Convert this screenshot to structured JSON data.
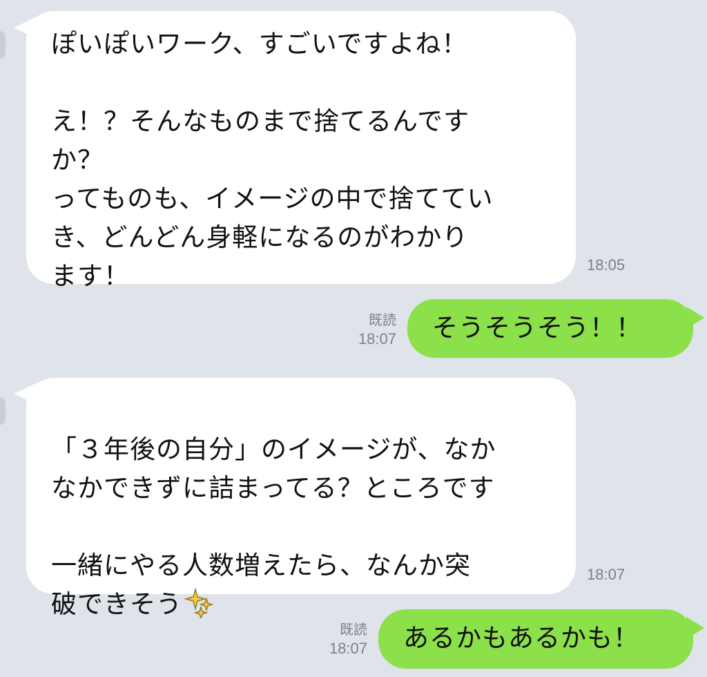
{
  "messages": [
    {
      "id": "m1",
      "direction": "incoming",
      "text": "ぽいぽいワーク、すごいですよね！\n\nえ！？そんなものまで捨てるんです\nか？\nってものも、イメージの中で捨ててい\nき、どんどん身軽になるのがわかり\nます！",
      "time": "18:05"
    },
    {
      "id": "m2",
      "direction": "outgoing",
      "text": "そうそうそう！！",
      "read": "既読",
      "time": "18:07"
    },
    {
      "id": "m3",
      "direction": "incoming",
      "text": "「３年後の自分」のイメージが、なか\nなかできずに詰まってる？ところです\n\n一緒にやる人数増えたら、なんか突\n破できそう",
      "emoji": "sparkles-icon",
      "time": "18:07"
    },
    {
      "id": "m4",
      "direction": "outgoing",
      "text": "あるかもあるかも！",
      "read": "既読",
      "time": "18:07"
    }
  ],
  "colors": {
    "background": "#dfe4ea",
    "incoming_bubble": "#ffffff",
    "outgoing_bubble": "#8ce04a",
    "meta_text": "#7a8088",
    "sparkle": "#f2c94c"
  }
}
